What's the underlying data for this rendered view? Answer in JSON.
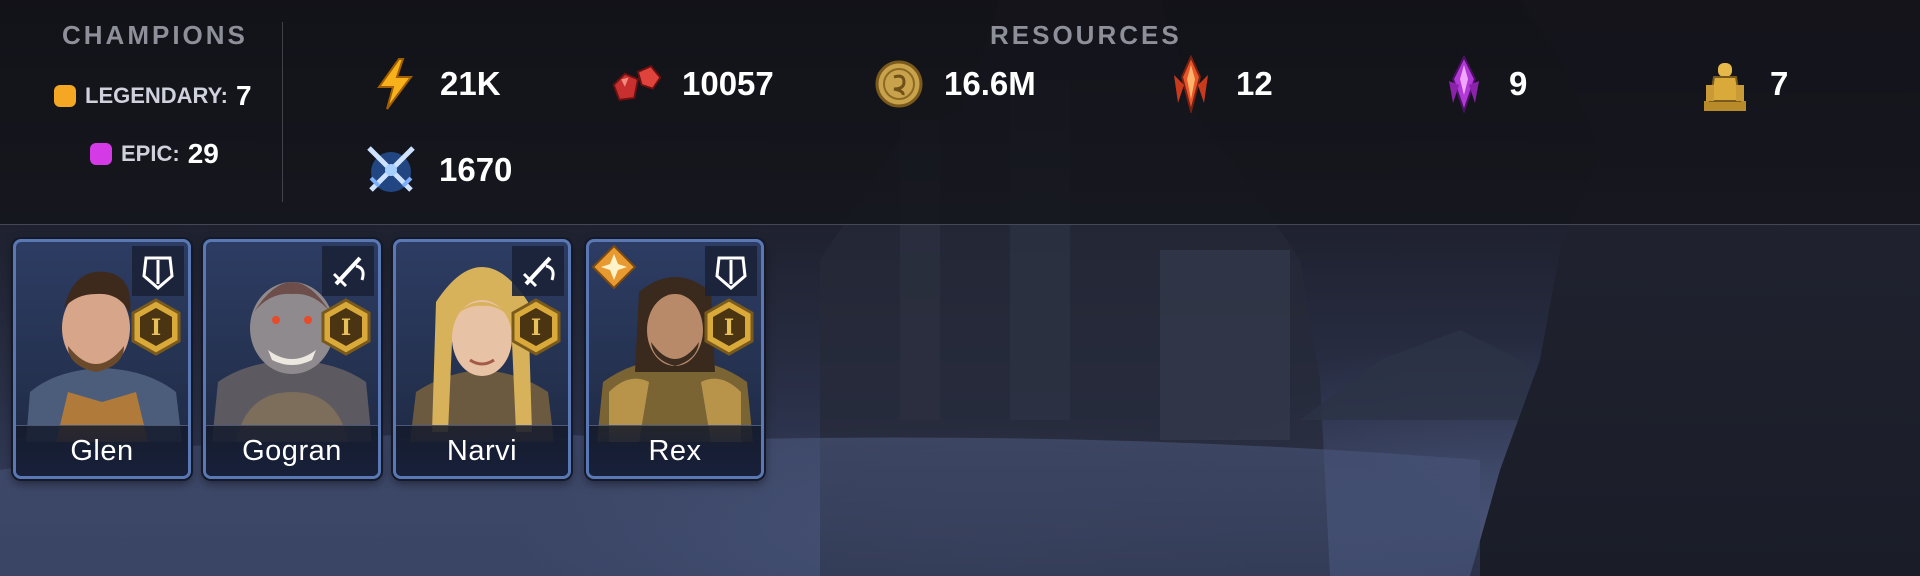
{
  "champions": {
    "title": "CHAMPIONS",
    "rarities": [
      {
        "label": "LEGENDARY:",
        "count": "7",
        "color": "#f5a623"
      },
      {
        "label": "EPIC:",
        "count": "29",
        "color": "#d43be6"
      }
    ]
  },
  "resources": {
    "title": "RESOURCES",
    "items": [
      {
        "icon": "energy-icon",
        "value": "21K"
      },
      {
        "icon": "ruby-gems-icon",
        "value": "10057"
      },
      {
        "icon": "silver-coin-icon",
        "value": "16.6M"
      },
      {
        "icon": "flame-shard-icon",
        "value": "12"
      },
      {
        "icon": "void-shard-icon",
        "value": "9"
      },
      {
        "icon": "golden-statue-icon",
        "value": "7"
      },
      {
        "icon": "crossed-swords-icon",
        "value": "1670"
      }
    ]
  },
  "cards": [
    {
      "name": "Glen",
      "class_icon": "defense-helmet-icon",
      "rank": "I",
      "affinity_icon": null
    },
    {
      "name": "Gogran",
      "class_icon": "attack-sword-icon",
      "rank": "I",
      "affinity_icon": null
    },
    {
      "name": "Narvi",
      "class_icon": "attack-sword-icon",
      "rank": "I",
      "affinity_icon": null
    },
    {
      "name": "Rex",
      "class_icon": "defense-helmet-icon",
      "rank": "I",
      "affinity_icon": "force-affinity-icon"
    }
  ],
  "colors": {
    "card_border": "#5a78b4",
    "rank_gold": "#d9a93a",
    "section_title": "#8d8f99"
  }
}
